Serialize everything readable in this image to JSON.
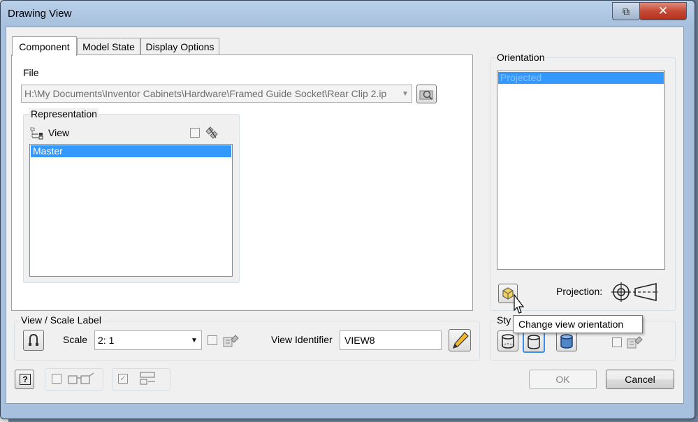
{
  "window": {
    "title": "Drawing View",
    "restore_glyph": "⧉",
    "close_glyph": "✕"
  },
  "tabs": [
    {
      "label": "Component"
    },
    {
      "label": "Model State"
    },
    {
      "label": "Display Options"
    }
  ],
  "file": {
    "label": "File",
    "path": "H:\\My Documents\\Inventor Cabinets\\Hardware\\Framed Guide Socket\\Rear Clip 2.ip"
  },
  "representation": {
    "label": "Representation",
    "view_label": "View",
    "items": [
      "Master"
    ]
  },
  "view_scale_label": {
    "label": "View / Scale Label",
    "scale_label": "Scale",
    "scale_value": "2: 1",
    "view_identifier_label": "View Identifier",
    "view_identifier_value": "VIEW8"
  },
  "orientation": {
    "label": "Orientation",
    "items": [
      "Projected"
    ],
    "projection_label": "Projection:"
  },
  "style": {
    "label": "Sty"
  },
  "tooltip": "Change view orientation",
  "buttons": {
    "ok": "OK",
    "cancel": "Cancel",
    "help": "?"
  },
  "colors": {
    "selection": "#3399ff",
    "frame": "#a7c0dd"
  }
}
